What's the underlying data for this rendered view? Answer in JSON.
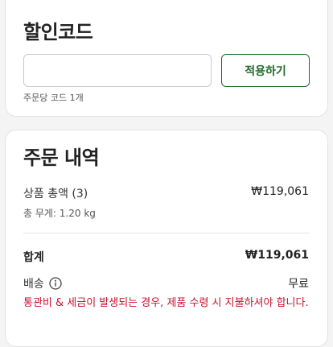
{
  "coupon": {
    "title": "할인코드",
    "input_value": "",
    "input_placeholder": "",
    "apply_label": "적용하기",
    "hint": "주문당 코드 1개"
  },
  "summary": {
    "title": "주문 내역",
    "items_label": "상품 총액 (3)",
    "items_value": "₩119,061",
    "weight_label": "총 무게: 1.20 kg",
    "total_label": "합계",
    "total_value": "₩119,061",
    "shipping_label": "배송",
    "shipping_icon": "info-icon",
    "shipping_value": "무료",
    "warning": "통관비 & 세금이 발생되는 경우, 제품 수령 시 지불하셔야 합니다."
  },
  "colors": {
    "accent": "#1e6b2a",
    "warning": "#c8102e",
    "background": "#f4f4f4",
    "card": "#ffffff"
  }
}
